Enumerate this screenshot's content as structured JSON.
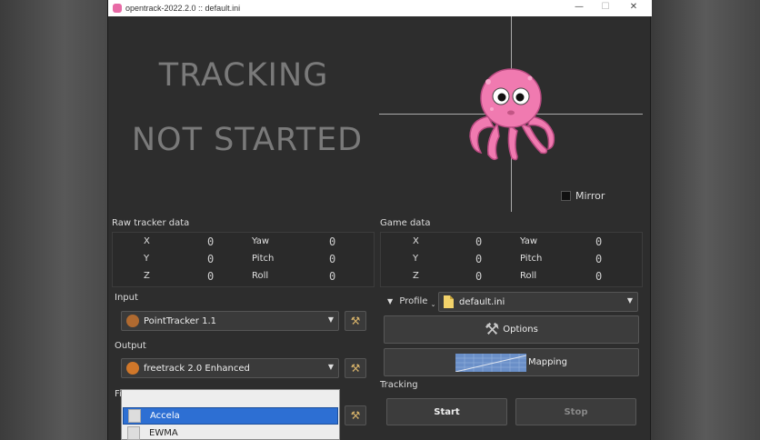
{
  "window": {
    "title": "opentrack-2022.2.0 :: default.ini",
    "minimize_glyph": "—",
    "maximize_glyph": "☐",
    "close_glyph": "✕"
  },
  "status": {
    "line1": "TRACKING",
    "line2": "NOT STARTED"
  },
  "mirror": {
    "label": "Mirror",
    "checked": false
  },
  "raw_tracker": {
    "title": "Raw tracker data",
    "rows": [
      {
        "a_label": "X",
        "a_value": "0",
        "b_label": "Yaw",
        "b_value": "0"
      },
      {
        "a_label": "Y",
        "a_value": "0",
        "b_label": "Pitch",
        "b_value": "0"
      },
      {
        "a_label": "Z",
        "a_value": "0",
        "b_label": "Roll",
        "b_value": "0"
      }
    ]
  },
  "game_data": {
    "title": "Game data",
    "rows": [
      {
        "a_label": "X",
        "a_value": "0",
        "b_label": "Yaw",
        "b_value": "0"
      },
      {
        "a_label": "Y",
        "a_value": "0",
        "b_label": "Pitch",
        "b_value": "0"
      },
      {
        "a_label": "Z",
        "a_value": "0",
        "b_label": "Roll",
        "b_value": "0"
      }
    ]
  },
  "input": {
    "label": "Input",
    "value": "PointTracker 1.1"
  },
  "output": {
    "label": "Output",
    "value": "freetrack 2.0 Enhanced"
  },
  "filter": {
    "label": "Fi",
    "options": [
      "Accela",
      "EWMA"
    ],
    "selected": "Accela"
  },
  "profile": {
    "label": "Profile",
    "value": "default.ini"
  },
  "buttons": {
    "options": "Options",
    "mapping": "Mapping",
    "start": "Start",
    "stop": "Stop"
  },
  "tracking_section": {
    "label": "Tracking"
  },
  "colors": {
    "background": "#2d2d2d",
    "status_text": "#7a7a7a",
    "octopus": "#f07ab0",
    "selection": "#2d6fd3"
  },
  "icons": {
    "app": "opentrack-octopus-icon",
    "tools": "hammer-icon",
    "options": "wrench-screwdriver-icon",
    "profile_file": "document-icon"
  }
}
